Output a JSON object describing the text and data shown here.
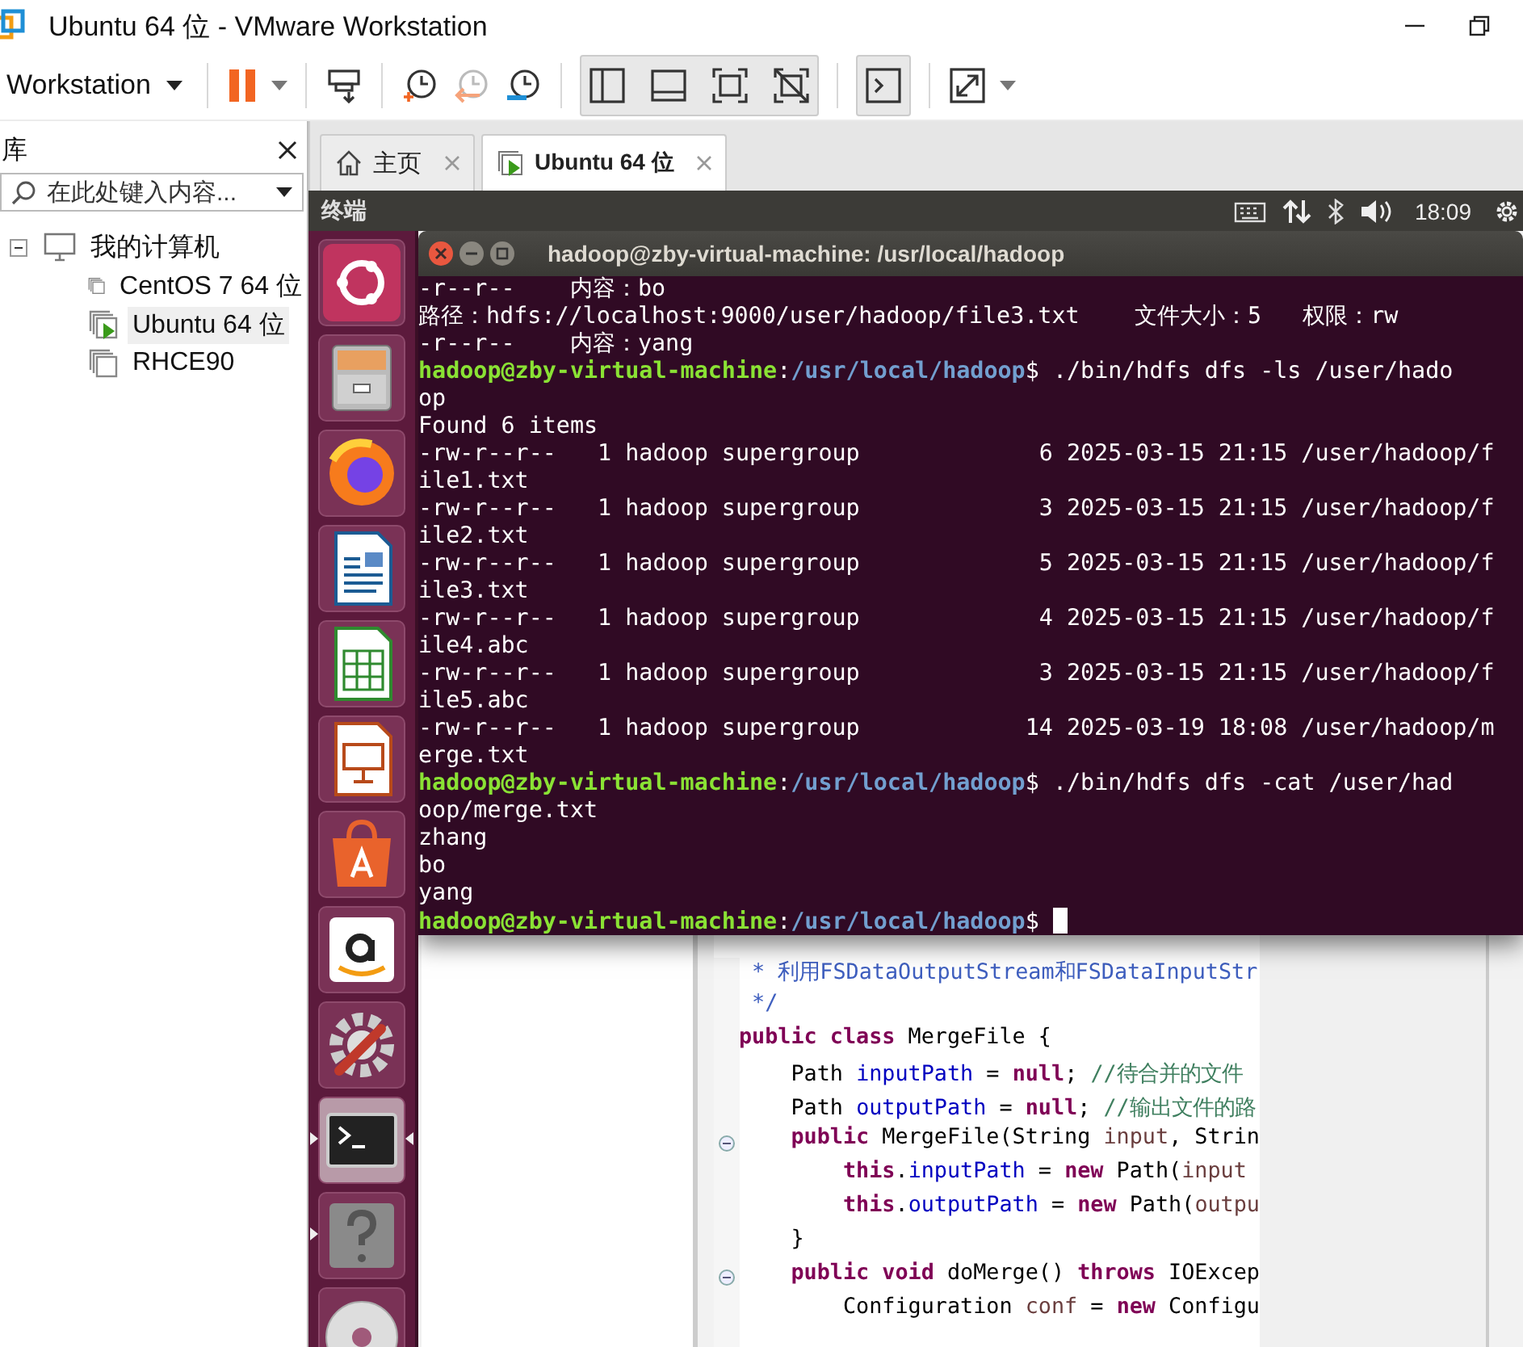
{
  "window": {
    "title": "Ubuntu 64 位 - VMware Workstation"
  },
  "toolbar": {
    "menu_label": "Workstation"
  },
  "library": {
    "title": "库",
    "search": {
      "placeholder": "在此处键入内容..."
    },
    "tree": [
      {
        "label": "我的计算机",
        "expanded": true,
        "selected": false,
        "children": [
          {
            "label": "CentOS 7 64 位",
            "running": false,
            "selected": false
          },
          {
            "label": "Ubuntu 64 位",
            "running": true,
            "selected": true
          },
          {
            "label": "RHCE90",
            "running": false,
            "selected": false
          }
        ]
      }
    ]
  },
  "tabs": [
    {
      "label": "主页",
      "kind": "home",
      "selected": false
    },
    {
      "label": "Ubuntu 64 位",
      "kind": "vm",
      "selected": true
    }
  ],
  "ubuntu_bar": {
    "app_title": "终端",
    "clock": "18:09"
  },
  "launcher": [
    {
      "kind": "dash",
      "running": false,
      "focused": false
    },
    {
      "kind": "files",
      "running": false,
      "focused": false
    },
    {
      "kind": "firefox",
      "running": false,
      "focused": false
    },
    {
      "kind": "writer",
      "running": false,
      "focused": false
    },
    {
      "kind": "calc",
      "running": false,
      "focused": false
    },
    {
      "kind": "impress",
      "running": false,
      "focused": false
    },
    {
      "kind": "software",
      "running": false,
      "focused": false
    },
    {
      "kind": "amazon",
      "running": false,
      "focused": false
    },
    {
      "kind": "settings",
      "running": false,
      "focused": false
    },
    {
      "kind": "terminal",
      "running": true,
      "focused": true
    },
    {
      "kind": "help",
      "running": true,
      "focused": false
    },
    {
      "kind": "dvd",
      "running": false,
      "focused": false
    }
  ],
  "terminal": {
    "title": "hadoop@zby-virtual-machine: /usr/local/hadoop",
    "lines": [
      {
        "kind": "output",
        "text": "-r--r--    内容：bo"
      },
      {
        "kind": "output",
        "text": "路径：hdfs://localhost:9000/user/hadoop/file3.txt    文件大小：5   权限：rw"
      },
      {
        "kind": "output",
        "text": "-r--r--    内容：yang"
      },
      {
        "kind": "prompt",
        "user": "hadoop@zby-virtual-machine",
        "separator": ":",
        "path": "/usr/local/hadoop",
        "command": "$ ./bin/hdfs dfs -ls /user/hado",
        "cursor": false
      },
      {
        "kind": "output",
        "text": "op"
      },
      {
        "kind": "output",
        "text": "Found 6 items"
      },
      {
        "kind": "output",
        "text": "-rw-r--r--   1 hadoop supergroup             6 2025-03-15 21:15 /user/hadoop/f"
      },
      {
        "kind": "output",
        "text": "ile1.txt"
      },
      {
        "kind": "output",
        "text": "-rw-r--r--   1 hadoop supergroup             3 2025-03-15 21:15 /user/hadoop/f"
      },
      {
        "kind": "output",
        "text": "ile2.txt"
      },
      {
        "kind": "output",
        "text": "-rw-r--r--   1 hadoop supergroup             5 2025-03-15 21:15 /user/hadoop/f"
      },
      {
        "kind": "output",
        "text": "ile3.txt"
      },
      {
        "kind": "output",
        "text": "-rw-r--r--   1 hadoop supergroup             4 2025-03-15 21:15 /user/hadoop/f"
      },
      {
        "kind": "output",
        "text": "ile4.abc"
      },
      {
        "kind": "output",
        "text": "-rw-r--r--   1 hadoop supergroup             3 2025-03-15 21:15 /user/hadoop/f"
      },
      {
        "kind": "output",
        "text": "ile5.abc"
      },
      {
        "kind": "output",
        "text": "-rw-r--r--   1 hadoop supergroup            14 2025-03-19 18:08 /user/hadoop/m"
      },
      {
        "kind": "output",
        "text": "erge.txt"
      },
      {
        "kind": "prompt",
        "user": "hadoop@zby-virtual-machine",
        "separator": ":",
        "path": "/usr/local/hadoop",
        "command": "$ ./bin/hdfs dfs -cat /user/had",
        "cursor": false
      },
      {
        "kind": "output",
        "text": "oop/merge.txt"
      },
      {
        "kind": "output",
        "text": "zhang"
      },
      {
        "kind": "output",
        "text": "bo"
      },
      {
        "kind": "output",
        "text": "yang"
      },
      {
        "kind": "prompt",
        "user": "hadoop@zby-virtual-machine",
        "separator": ":",
        "path": "/usr/local/hadoop",
        "command": "$",
        "cursor": true
      }
    ]
  },
  "editor": {
    "lines": [
      {
        "fold": false,
        "tokens": [
          {
            "kind": "doc",
            "text": " * 利用FSDataOutputStream和FSDataInputStr"
          }
        ]
      },
      {
        "fold": false,
        "tokens": [
          {
            "kind": "doc",
            "text": " */"
          }
        ]
      },
      {
        "fold": false,
        "tokens": [
          {
            "kind": "kw",
            "text": "public class"
          },
          {
            "kind": "plain",
            "text": " MergeFile {"
          }
        ]
      },
      {
        "fold": false,
        "tokens": [
          {
            "kind": "plain",
            "text": "    Path "
          },
          {
            "kind": "field",
            "text": "inputPath"
          },
          {
            "kind": "plain",
            "text": " = "
          },
          {
            "kind": "kw",
            "text": "null"
          },
          {
            "kind": "plain",
            "text": "; "
          },
          {
            "kind": "comment",
            "text": "//待合并的文件"
          }
        ]
      },
      {
        "fold": false,
        "tokens": [
          {
            "kind": "plain",
            "text": "    Path "
          },
          {
            "kind": "field",
            "text": "outputPath"
          },
          {
            "kind": "plain",
            "text": " = "
          },
          {
            "kind": "kw",
            "text": "null"
          },
          {
            "kind": "plain",
            "text": "; "
          },
          {
            "kind": "comment",
            "text": "//输出文件的路"
          }
        ]
      },
      {
        "fold": true,
        "tokens": [
          {
            "kind": "kw",
            "text": "    public"
          },
          {
            "kind": "plain",
            "text": " MergeFile(String "
          },
          {
            "kind": "param",
            "text": "input"
          },
          {
            "kind": "plain",
            "text": ", Strin"
          }
        ]
      },
      {
        "fold": false,
        "tokens": [
          {
            "kind": "kw",
            "text": "        this"
          },
          {
            "kind": "plain",
            "text": "."
          },
          {
            "kind": "field",
            "text": "inputPath"
          },
          {
            "kind": "plain",
            "text": " = "
          },
          {
            "kind": "kw",
            "text": "new"
          },
          {
            "kind": "plain",
            "text": " Path("
          },
          {
            "kind": "param",
            "text": "input"
          }
        ]
      },
      {
        "fold": false,
        "tokens": [
          {
            "kind": "kw",
            "text": "        this"
          },
          {
            "kind": "plain",
            "text": "."
          },
          {
            "kind": "field",
            "text": "outputPath"
          },
          {
            "kind": "plain",
            "text": " = "
          },
          {
            "kind": "kw",
            "text": "new"
          },
          {
            "kind": "plain",
            "text": " Path("
          },
          {
            "kind": "param",
            "text": "outpu"
          }
        ]
      },
      {
        "fold": false,
        "tokens": [
          {
            "kind": "plain",
            "text": "    }"
          }
        ]
      },
      {
        "fold": true,
        "tokens": [
          {
            "kind": "kw",
            "text": "    public void"
          },
          {
            "kind": "plain",
            "text": " doMerge() "
          },
          {
            "kind": "kw",
            "text": "throws"
          },
          {
            "kind": "plain",
            "text": " IOExcep"
          }
        ]
      },
      {
        "fold": false,
        "tokens": [
          {
            "kind": "plain",
            "text": "        Configuration "
          },
          {
            "kind": "param",
            "text": "conf"
          },
          {
            "kind": "plain",
            "text": " = "
          },
          {
            "kind": "kw",
            "text": "new"
          },
          {
            "kind": "plain",
            "text": " Configu"
          }
        ]
      }
    ]
  }
}
